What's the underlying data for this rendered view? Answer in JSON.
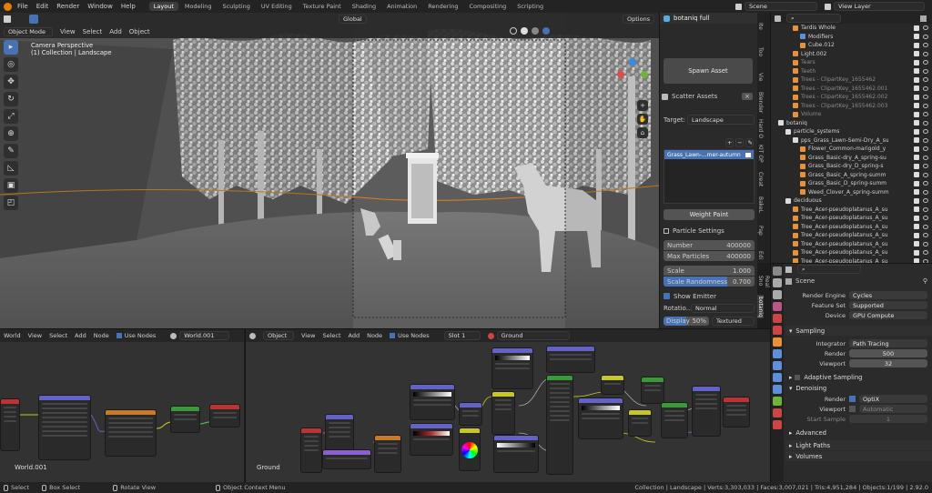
{
  "topbar": {
    "menus": [
      "File",
      "Edit",
      "Render",
      "Window",
      "Help"
    ],
    "workspaces": [
      "Layout",
      "Modeling",
      "Sculpting",
      "UV Editing",
      "Texture Paint",
      "Shading",
      "Animation",
      "Rendering",
      "Compositing",
      "Scripting"
    ],
    "active_workspace": "Layout",
    "scene": "Scene",
    "view_layer": "View Layer"
  },
  "viewport": {
    "mode": "Object Mode",
    "menus": [
      "View",
      "Select",
      "Add",
      "Object"
    ],
    "transform": "Global",
    "options_label": "Options",
    "overlay_title": "Camera Perspective",
    "overlay_subtitle": "(1) Collection | Landscape"
  },
  "npanel": {
    "addon": "botaniq full",
    "spawn_asset": "Spawn Asset",
    "scatter_assets": "Scatter Assets",
    "target_label": "Target:",
    "target_value": "Landscape",
    "list_item": "Grass_Lawn-...mer-autumn",
    "weight_paint": "Weight Paint",
    "particle_settings": "Particle Settings",
    "number_label": "Number",
    "number_value": "400000",
    "max_particles_label": "Max Particles",
    "max_particles_value": "400000",
    "scale_label": "Scale",
    "scale_value": "1.000",
    "scale_rand_label": "Scale Randomness",
    "scale_rand_value": "0.700",
    "show_emitter": "Show Emitter",
    "rotation_label": "Rotatio...",
    "rotation_value": "Normal",
    "display_label": "Display",
    "display_value": "50%",
    "display_mode": "Textured"
  },
  "vtabs": [
    "Ite",
    "Too",
    "Vie",
    "Blender",
    "Hard O",
    "KIT OP",
    "Creat",
    "BakeL",
    "Pap",
    "Edi",
    "Real Sno",
    "botaniq"
  ],
  "outliner": {
    "rows": [
      {
        "label": "Tardis Whole",
        "indent": 3,
        "color": "#e8903a",
        "dim": false
      },
      {
        "label": "Modifiers",
        "indent": 4,
        "color": "#5e8fd8",
        "dim": false
      },
      {
        "label": "Cube.012",
        "indent": 4,
        "color": "#e8903a",
        "dim": false
      },
      {
        "label": "Light.002",
        "indent": 3,
        "color": "#e8903a",
        "dim": false
      },
      {
        "label": "Tears",
        "indent": 3,
        "color": "#e8903a",
        "dim": true
      },
      {
        "label": "Teeth",
        "indent": 3,
        "color": "#e8903a",
        "dim": true
      },
      {
        "label": "Trees - ClipartKey_1655462",
        "indent": 3,
        "color": "#e8903a",
        "dim": true
      },
      {
        "label": "Trees - ClipartKey_1655462.001",
        "indent": 3,
        "color": "#e8903a",
        "dim": true
      },
      {
        "label": "Trees - ClipartKey_1655462.002",
        "indent": 3,
        "color": "#e8903a",
        "dim": true
      },
      {
        "label": "Trees - ClipartKey_1655462.003",
        "indent": 3,
        "color": "#e8903a",
        "dim": true
      },
      {
        "label": "Volume",
        "indent": 3,
        "color": "#e8903a",
        "dim": true
      },
      {
        "label": "botaniq",
        "indent": 1,
        "color": "#dddddd",
        "dim": false
      },
      {
        "label": "particle_systems",
        "indent": 2,
        "color": "#dddddd",
        "dim": false
      },
      {
        "label": "pps_Grass_Lawn-Semi-Dry_A_su",
        "indent": 3,
        "color": "#dddddd",
        "dim": false
      },
      {
        "label": "Flower_Common-marigold_y",
        "indent": 4,
        "color": "#e8903a",
        "dim": false
      },
      {
        "label": "Grass_Basic-dry_A_spring-su",
        "indent": 4,
        "color": "#e8903a",
        "dim": false
      },
      {
        "label": "Grass_Basic-dry_D_spring-s",
        "indent": 4,
        "color": "#e8903a",
        "dim": false
      },
      {
        "label": "Grass_Basic_A_spring-summ",
        "indent": 4,
        "color": "#e8903a",
        "dim": false
      },
      {
        "label": "Grass_Basic_D_spring-summ",
        "indent": 4,
        "color": "#e8903a",
        "dim": false
      },
      {
        "label": "Weed_Clover_A_spring-summ",
        "indent": 4,
        "color": "#e8903a",
        "dim": false
      },
      {
        "label": "deciduous",
        "indent": 2,
        "color": "#dddddd",
        "dim": false
      },
      {
        "label": "Tree_Acer-pseudoplatanus_A_su",
        "indent": 3,
        "color": "#e8903a",
        "dim": false
      },
      {
        "label": "Tree_Acer-pseudoplatanus_A_su",
        "indent": 3,
        "color": "#e8903a",
        "dim": false
      },
      {
        "label": "Tree_Acer-pseudoplatanus_A_su",
        "indent": 3,
        "color": "#e8903a",
        "dim": false
      },
      {
        "label": "Tree_Acer-pseudoplatanus_A_su",
        "indent": 3,
        "color": "#e8903a",
        "dim": false
      },
      {
        "label": "Tree_Acer-pseudoplatanus_A_su",
        "indent": 3,
        "color": "#e8903a",
        "dim": false
      },
      {
        "label": "Tree_Acer-pseudoplatanus_A_su",
        "indent": 3,
        "color": "#e8903a",
        "dim": false
      },
      {
        "label": "Tree_Acer-pseudoplatanus_A_su",
        "indent": 3,
        "color": "#e8903a",
        "dim": false
      }
    ]
  },
  "properties": {
    "scene": "Scene",
    "render_engine_label": "Render Engine",
    "render_engine": "Cycles",
    "feature_set_label": "Feature Set",
    "feature_set": "Supported",
    "device_label": "Device",
    "device": "GPU Compute",
    "sampling": "Sampling",
    "integrator_label": "Integrator",
    "integrator": "Path Tracing",
    "render_label": "Render",
    "render_samples": "500",
    "viewport_label": "Viewport",
    "viewport_samples": "32",
    "adaptive": "Adaptive Sampling",
    "denoising": "Denoising",
    "den_render_label": "Render",
    "den_render": "OptiX",
    "den_viewport_label": "Viewport",
    "den_viewport": "Automatic",
    "start_sample_label": "Start Sample",
    "start_sample": "1",
    "advanced": "Advanced",
    "light_paths": "Light Paths",
    "volumes": "Volumes"
  },
  "ne1": {
    "editor": "World",
    "menus": [
      "View",
      "Select",
      "Add",
      "Node"
    ],
    "use_nodes": "Use Nodes",
    "world_name": "World.001",
    "footer": "World.001"
  },
  "ne2": {
    "object": "Object",
    "menus": [
      "View",
      "Select",
      "Add",
      "Node"
    ],
    "use_nodes": "Use Nodes",
    "slot": "Slot 1",
    "material": "Ground",
    "footer": "Ground"
  },
  "status": {
    "select": "Select",
    "box_select": "Box Select",
    "rotate_view": "Rotate View",
    "context_menu": "Object Context Menu",
    "stats": "Collection | Landscape | Verts:3,303,033 | Faces:3,007,021 | Tris:4,951,284 | Objects:1/199 | 2.92.0"
  }
}
